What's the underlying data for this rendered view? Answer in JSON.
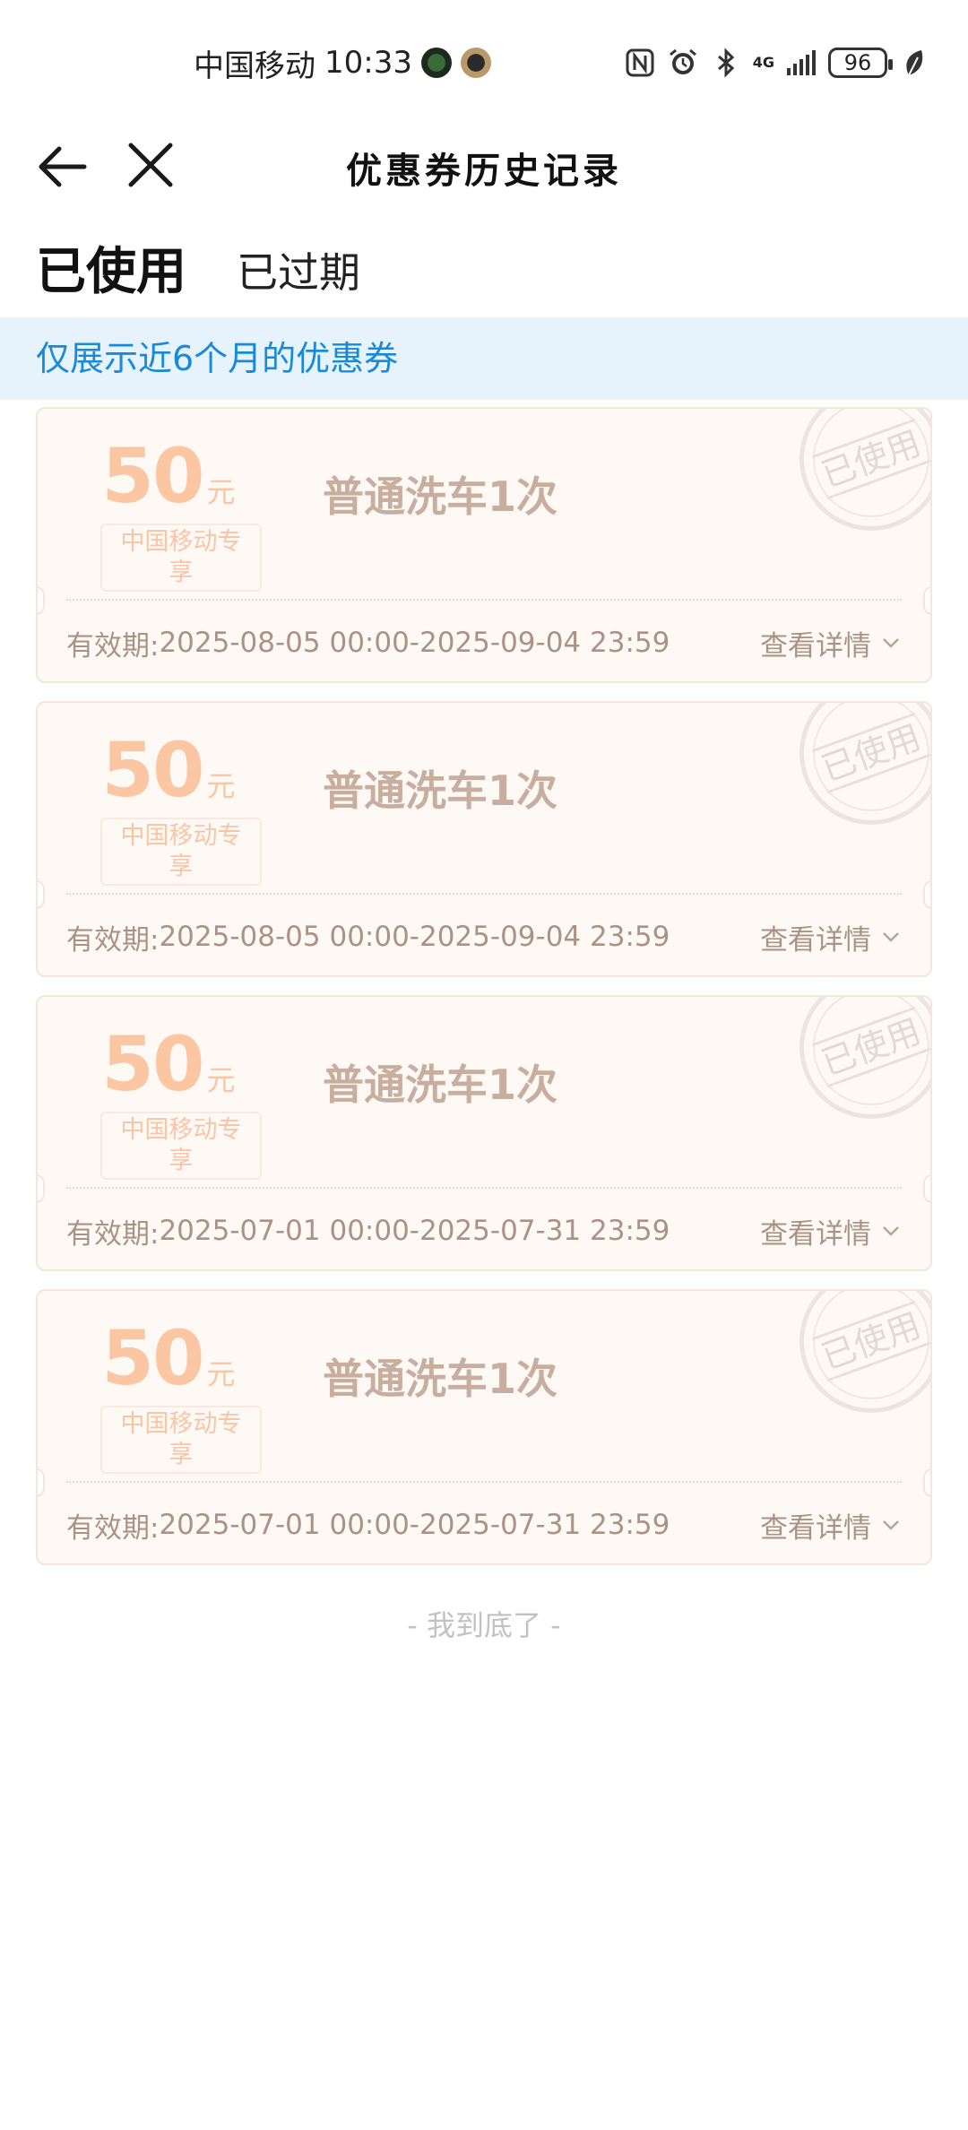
{
  "status_bar": {
    "carrier": "中国移动",
    "time": "10:33",
    "network": "4G",
    "battery": "96"
  },
  "nav": {
    "title": "优惠券历史记录",
    "back_icon": "arrow-left-icon",
    "close_icon": "close-icon"
  },
  "tabs": [
    {
      "label": "已使用",
      "active": true
    },
    {
      "label": "已过期",
      "active": false
    }
  ],
  "notice": "仅展示近6个月的优惠券",
  "coupons": [
    {
      "amount": "50",
      "unit": "元",
      "tag": "中国移动专享",
      "name": "普通洗车1次",
      "validity_label": "有效期:",
      "validity": "2025-08-05 00:00-2025-09-04 23:59",
      "details": "查看详情",
      "stamp": "已使用"
    },
    {
      "amount": "50",
      "unit": "元",
      "tag": "中国移动专享",
      "name": "普通洗车1次",
      "validity_label": "有效期:",
      "validity": "2025-08-05 00:00-2025-09-04 23:59",
      "details": "查看详情",
      "stamp": "已使用"
    },
    {
      "amount": "50",
      "unit": "元",
      "tag": "中国移动专享",
      "name": "普通洗车1次",
      "validity_label": "有效期:",
      "validity": "2025-07-01 00:00-2025-07-31 23:59",
      "details": "查看详情",
      "stamp": "已使用"
    },
    {
      "amount": "50",
      "unit": "元",
      "tag": "中国移动专享",
      "name": "普通洗车1次",
      "validity_label": "有效期:",
      "validity": "2025-07-01 00:00-2025-07-31 23:59",
      "details": "查看详情",
      "stamp": "已使用"
    }
  ],
  "end_text": "- 我到底了 -",
  "colors": {
    "accent_blue": "#1677ff",
    "notice_bg": "#e6f3fc",
    "notice_text": "#1a8ad8",
    "coupon_amount": "#fbc7a3",
    "coupon_name": "#c8ae9e"
  }
}
